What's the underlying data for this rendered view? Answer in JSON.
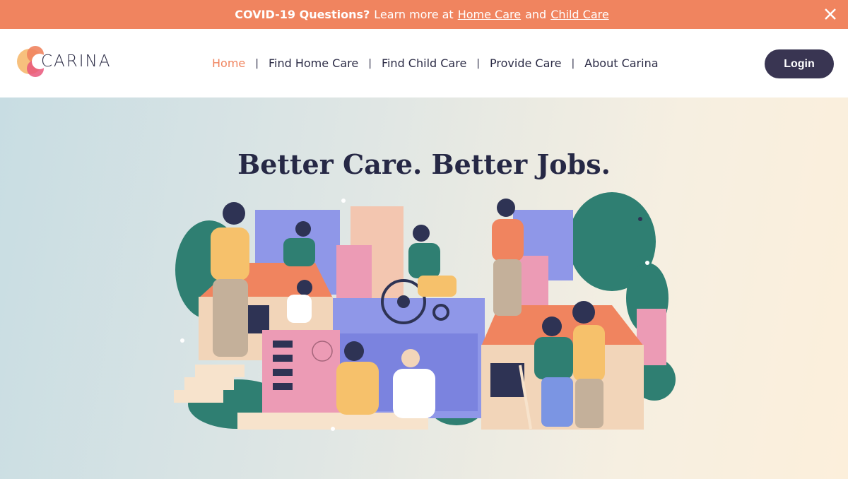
{
  "banner": {
    "bold_text": "COVID-19 Questions?",
    "text": "Learn more at",
    "link_home": "Home Care",
    "and_text": "and",
    "link_child": "Child Care"
  },
  "header": {
    "logo_text": "CARINA",
    "nav": [
      {
        "label": "Home",
        "active": true
      },
      {
        "label": "Find Home Care"
      },
      {
        "label": "Find Child Care"
      },
      {
        "label": "Provide Care"
      },
      {
        "label": "About Carina"
      }
    ],
    "login_label": "Login"
  },
  "hero": {
    "headline": "Better Care. Better Jobs."
  },
  "colors": {
    "accent": "#f0845f",
    "navy": "#393552",
    "teal": "#2f7f72"
  }
}
